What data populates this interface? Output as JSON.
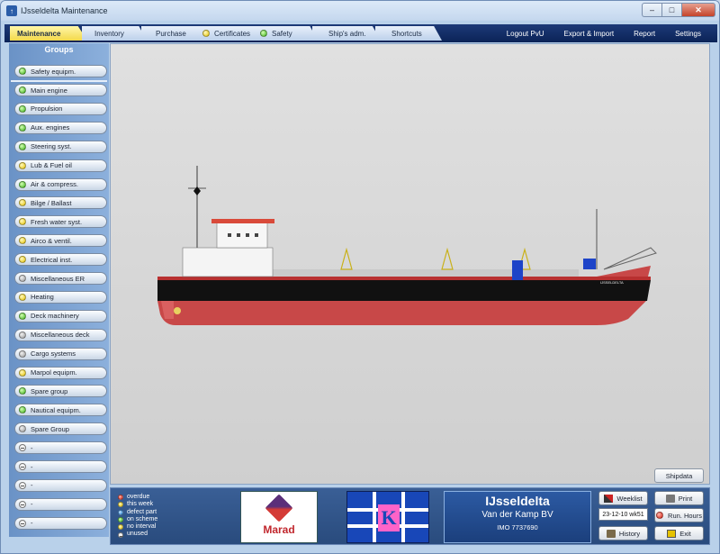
{
  "window": {
    "title": "IJsseldelta Maintenance"
  },
  "tabs": [
    {
      "label": "Maintenance",
      "active": true,
      "status": ""
    },
    {
      "label": "Inventory",
      "active": false,
      "status": ""
    },
    {
      "label": "Purchase",
      "active": false,
      "status": ""
    },
    {
      "label": "Certificates",
      "active": false,
      "status": "yellow"
    },
    {
      "label": "Safety",
      "active": false,
      "status": "green"
    },
    {
      "label": "Ship's adm.",
      "active": false,
      "status": ""
    },
    {
      "label": "Shortcuts",
      "active": false,
      "status": ""
    }
  ],
  "right_menu": [
    "Logout PvU",
    "Export & Import",
    "Report",
    "Settings"
  ],
  "sidebar": {
    "title": "Groups",
    "items": [
      {
        "label": "Safety equipm.",
        "status": "green"
      },
      {
        "label": "Main engine",
        "status": "green"
      },
      {
        "label": "Propulsion",
        "status": "green"
      },
      {
        "label": "Aux. engines",
        "status": "green"
      },
      {
        "label": "Steering syst.",
        "status": "green"
      },
      {
        "label": "Lub & Fuel oil",
        "status": "yellow"
      },
      {
        "label": "Air & compress.",
        "status": "green"
      },
      {
        "label": "Bilge / Ballast",
        "status": "yellow"
      },
      {
        "label": "Fresh water syst.",
        "status": "yellow"
      },
      {
        "label": "Airco & ventil.",
        "status": "yellow"
      },
      {
        "label": "Electrical inst.",
        "status": "yellow"
      },
      {
        "label": "Miscellaneous ER",
        "status": "grey"
      },
      {
        "label": "Heating",
        "status": "yellow"
      },
      {
        "label": "Deck machinery",
        "status": "green"
      },
      {
        "label": "Miscellaneous deck",
        "status": "grey"
      },
      {
        "label": "Cargo systems",
        "status": "grey"
      },
      {
        "label": "Marpol equipm.",
        "status": "yellow"
      },
      {
        "label": "Spare group",
        "status": "green"
      },
      {
        "label": "Nautical equipm.",
        "status": "green"
      },
      {
        "label": "Spare Group",
        "status": "grey"
      },
      {
        "label": "-",
        "status": "unused"
      },
      {
        "label": "-",
        "status": "unused"
      },
      {
        "label": "-",
        "status": "unused"
      },
      {
        "label": "-",
        "status": "unused"
      },
      {
        "label": "-",
        "status": "unused"
      }
    ]
  },
  "main": {
    "shipdata_label": "Shipdata"
  },
  "legend": [
    {
      "label": "overdue",
      "color": "red"
    },
    {
      "label": "this week",
      "color": "yellow"
    },
    {
      "label": "defect part",
      "color": "blue"
    },
    {
      "label": "on scheme",
      "color": "green"
    },
    {
      "label": "no interval",
      "color": "yellow"
    },
    {
      "label": "unused",
      "color": "unused"
    }
  ],
  "branding": {
    "marad": "Marad",
    "flag_letter": "K"
  },
  "ship": {
    "name": "IJsseldelta",
    "owner": "Van der Kamp BV",
    "imo": "IMO 7737690",
    "hull_name": "IJSSELDELTA"
  },
  "actions": {
    "weeklist": "Weeklist",
    "week_value": "23-12-10 wk51",
    "history": "History",
    "print": "Print",
    "run_hours": "Run. Hours",
    "exit": "Exit"
  },
  "colors": {
    "tabbar": "#0b2357",
    "hull_red": "#c84848",
    "hull_black": "#101010",
    "funnel_blue": "#1e44c8"
  }
}
